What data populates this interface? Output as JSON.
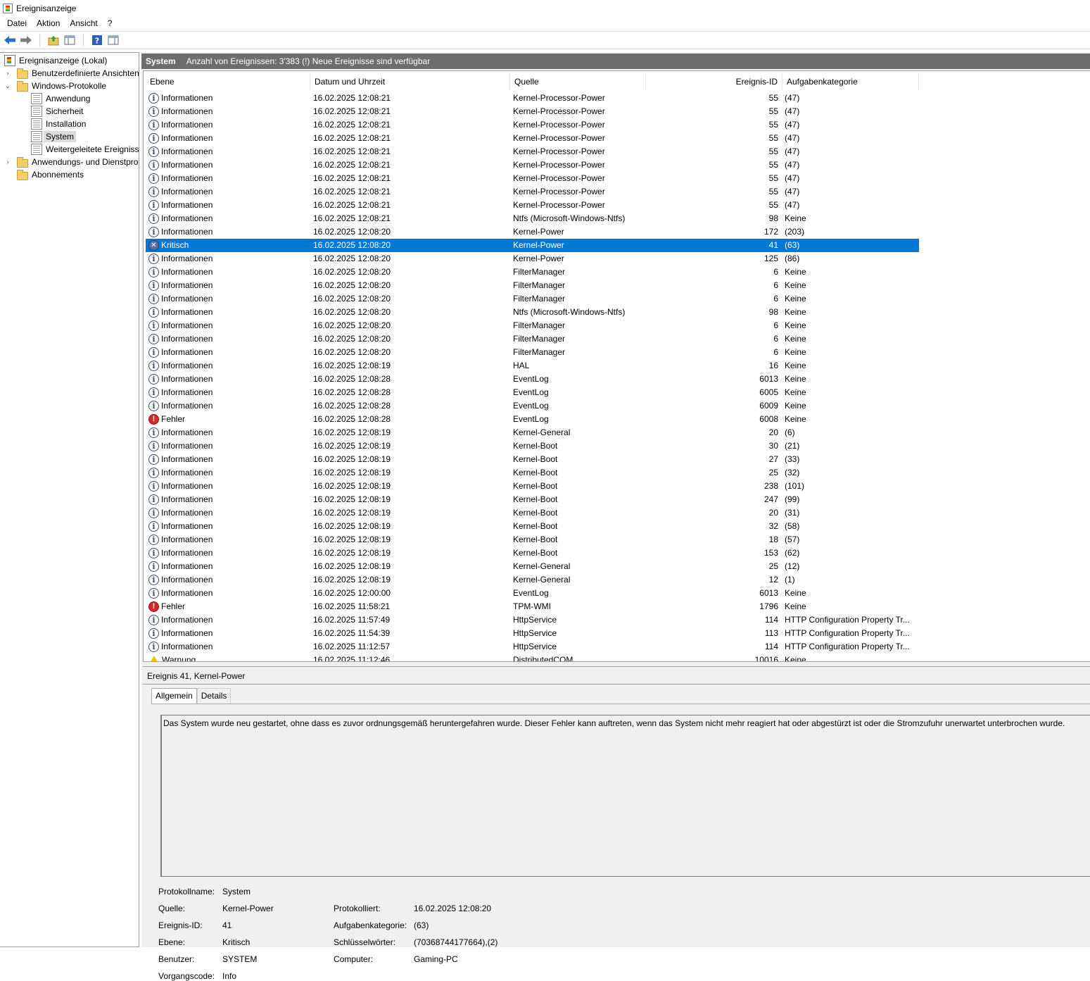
{
  "window": {
    "title": "Ereignisanzeige"
  },
  "menu": [
    "Datei",
    "Aktion",
    "Ansicht",
    "?"
  ],
  "toolbar": {
    "icons": [
      "back-arrow-icon",
      "forward-arrow-icon",
      "up-folder-icon",
      "show-hide-console-tree-icon",
      "help-icon",
      "show-hide-action-pane-icon"
    ],
    "colors": {
      "arrow": "#2b6fc9",
      "folder": "#3b9a3b"
    }
  },
  "tree": {
    "items": [
      {
        "label": "Ereignisanzeige (Lokal)",
        "icon": "event-viewer-icon",
        "level": 0,
        "chevron": ""
      },
      {
        "label": "Benutzerdefinierte Ansichten",
        "icon": "folder-icon",
        "level": 1,
        "chevron": "›"
      },
      {
        "label": "Windows-Protokolle",
        "icon": "folder-icon",
        "level": 1,
        "chevron": "⌄"
      },
      {
        "label": "Anwendung",
        "icon": "log-icon",
        "level": 2,
        "chevron": ""
      },
      {
        "label": "Sicherheit",
        "icon": "log-icon",
        "level": 2,
        "chevron": ""
      },
      {
        "label": "Installation",
        "icon": "log-icon",
        "level": 2,
        "chevron": ""
      },
      {
        "label": "System",
        "icon": "log-icon",
        "level": 2,
        "chevron": "",
        "selected": true
      },
      {
        "label": "Weitergeleitete Ereignisse",
        "icon": "log-icon",
        "level": 2,
        "chevron": ""
      },
      {
        "label": "Anwendungs- und Dienstprotokolle",
        "icon": "folder-icon",
        "level": 1,
        "chevron": "›"
      },
      {
        "label": "Abonnements",
        "icon": "subscriptions-icon",
        "level": 1,
        "chevron": ""
      }
    ]
  },
  "header": {
    "title": "System",
    "info": "Anzahl von Ereignissen: 3'383 (!) Neue Ereignisse sind verfügbar",
    "color": "#6d6d6d"
  },
  "columns": [
    "Ebene",
    "Datum und Uhrzeit",
    "Quelle",
    "Ereignis-ID",
    "Aufgabenkategorie"
  ],
  "events": [
    {
      "level": "Informationen",
      "type": "info",
      "date": "16.02.2025 12:08:21",
      "source": "Kernel-Processor-Power",
      "id": "55",
      "cat": "(47)"
    },
    {
      "level": "Informationen",
      "type": "info",
      "date": "16.02.2025 12:08:21",
      "source": "Kernel-Processor-Power",
      "id": "55",
      "cat": "(47)"
    },
    {
      "level": "Informationen",
      "type": "info",
      "date": "16.02.2025 12:08:21",
      "source": "Kernel-Processor-Power",
      "id": "55",
      "cat": "(47)"
    },
    {
      "level": "Informationen",
      "type": "info",
      "date": "16.02.2025 12:08:21",
      "source": "Kernel-Processor-Power",
      "id": "55",
      "cat": "(47)"
    },
    {
      "level": "Informationen",
      "type": "info",
      "date": "16.02.2025 12:08:21",
      "source": "Kernel-Processor-Power",
      "id": "55",
      "cat": "(47)"
    },
    {
      "level": "Informationen",
      "type": "info",
      "date": "16.02.2025 12:08:21",
      "source": "Kernel-Processor-Power",
      "id": "55",
      "cat": "(47)"
    },
    {
      "level": "Informationen",
      "type": "info",
      "date": "16.02.2025 12:08:21",
      "source": "Kernel-Processor-Power",
      "id": "55",
      "cat": "(47)"
    },
    {
      "level": "Informationen",
      "type": "info",
      "date": "16.02.2025 12:08:21",
      "source": "Kernel-Processor-Power",
      "id": "55",
      "cat": "(47)"
    },
    {
      "level": "Informationen",
      "type": "info",
      "date": "16.02.2025 12:08:21",
      "source": "Kernel-Processor-Power",
      "id": "55",
      "cat": "(47)"
    },
    {
      "level": "Informationen",
      "type": "info",
      "date": "16.02.2025 12:08:21",
      "source": "Ntfs (Microsoft-Windows-Ntfs)",
      "id": "98",
      "cat": "Keine"
    },
    {
      "level": "Informationen",
      "type": "info",
      "date": "16.02.2025 12:08:20",
      "source": "Kernel-Power",
      "id": "172",
      "cat": "(203)"
    },
    {
      "level": "Kritisch",
      "type": "critical",
      "date": "16.02.2025 12:08:20",
      "source": "Kernel-Power",
      "id": "41",
      "cat": "(63)",
      "selected": true
    },
    {
      "level": "Informationen",
      "type": "info",
      "date": "16.02.2025 12:08:20",
      "source": "Kernel-Power",
      "id": "125",
      "cat": "(86)"
    },
    {
      "level": "Informationen",
      "type": "info",
      "date": "16.02.2025 12:08:20",
      "source": "FilterManager",
      "id": "6",
      "cat": "Keine"
    },
    {
      "level": "Informationen",
      "type": "info",
      "date": "16.02.2025 12:08:20",
      "source": "FilterManager",
      "id": "6",
      "cat": "Keine"
    },
    {
      "level": "Informationen",
      "type": "info",
      "date": "16.02.2025 12:08:20",
      "source": "FilterManager",
      "id": "6",
      "cat": "Keine"
    },
    {
      "level": "Informationen",
      "type": "info",
      "date": "16.02.2025 12:08:20",
      "source": "Ntfs (Microsoft-Windows-Ntfs)",
      "id": "98",
      "cat": "Keine"
    },
    {
      "level": "Informationen",
      "type": "info",
      "date": "16.02.2025 12:08:20",
      "source": "FilterManager",
      "id": "6",
      "cat": "Keine"
    },
    {
      "level": "Informationen",
      "type": "info",
      "date": "16.02.2025 12:08:20",
      "source": "FilterManager",
      "id": "6",
      "cat": "Keine"
    },
    {
      "level": "Informationen",
      "type": "info",
      "date": "16.02.2025 12:08:20",
      "source": "FilterManager",
      "id": "6",
      "cat": "Keine"
    },
    {
      "level": "Informationen",
      "type": "info",
      "date": "16.02.2025 12:08:19",
      "source": "HAL",
      "id": "16",
      "cat": "Keine"
    },
    {
      "level": "Informationen",
      "type": "info",
      "date": "16.02.2025 12:08:28",
      "source": "EventLog",
      "id": "6013",
      "cat": "Keine"
    },
    {
      "level": "Informationen",
      "type": "info",
      "date": "16.02.2025 12:08:28",
      "source": "EventLog",
      "id": "6005",
      "cat": "Keine"
    },
    {
      "level": "Informationen",
      "type": "info",
      "date": "16.02.2025 12:08:28",
      "source": "EventLog",
      "id": "6009",
      "cat": "Keine"
    },
    {
      "level": "Fehler",
      "type": "error",
      "date": "16.02.2025 12:08:28",
      "source": "EventLog",
      "id": "6008",
      "cat": "Keine"
    },
    {
      "level": "Informationen",
      "type": "info",
      "date": "16.02.2025 12:08:19",
      "source": "Kernel-General",
      "id": "20",
      "cat": "(6)"
    },
    {
      "level": "Informationen",
      "type": "info",
      "date": "16.02.2025 12:08:19",
      "source": "Kernel-Boot",
      "id": "30",
      "cat": "(21)"
    },
    {
      "level": "Informationen",
      "type": "info",
      "date": "16.02.2025 12:08:19",
      "source": "Kernel-Boot",
      "id": "27",
      "cat": "(33)"
    },
    {
      "level": "Informationen",
      "type": "info",
      "date": "16.02.2025 12:08:19",
      "source": "Kernel-Boot",
      "id": "25",
      "cat": "(32)"
    },
    {
      "level": "Informationen",
      "type": "info",
      "date": "16.02.2025 12:08:19",
      "source": "Kernel-Boot",
      "id": "238",
      "cat": "(101)"
    },
    {
      "level": "Informationen",
      "type": "info",
      "date": "16.02.2025 12:08:19",
      "source": "Kernel-Boot",
      "id": "247",
      "cat": "(99)"
    },
    {
      "level": "Informationen",
      "type": "info",
      "date": "16.02.2025 12:08:19",
      "source": "Kernel-Boot",
      "id": "20",
      "cat": "(31)"
    },
    {
      "level": "Informationen",
      "type": "info",
      "date": "16.02.2025 12:08:19",
      "source": "Kernel-Boot",
      "id": "32",
      "cat": "(58)"
    },
    {
      "level": "Informationen",
      "type": "info",
      "date": "16.02.2025 12:08:19",
      "source": "Kernel-Boot",
      "id": "18",
      "cat": "(57)"
    },
    {
      "level": "Informationen",
      "type": "info",
      "date": "16.02.2025 12:08:19",
      "source": "Kernel-Boot",
      "id": "153",
      "cat": "(62)"
    },
    {
      "level": "Informationen",
      "type": "info",
      "date": "16.02.2025 12:08:19",
      "source": "Kernel-General",
      "id": "25",
      "cat": "(12)"
    },
    {
      "level": "Informationen",
      "type": "info",
      "date": "16.02.2025 12:08:19",
      "source": "Kernel-General",
      "id": "12",
      "cat": "(1)"
    },
    {
      "level": "Informationen",
      "type": "info",
      "date": "16.02.2025 12:00:00",
      "source": "EventLog",
      "id": "6013",
      "cat": "Keine"
    },
    {
      "level": "Fehler",
      "type": "error",
      "date": "16.02.2025 11:58:21",
      "source": "TPM-WMI",
      "id": "1796",
      "cat": "Keine"
    },
    {
      "level": "Informationen",
      "type": "info",
      "date": "16.02.2025 11:57:49",
      "source": "HttpService",
      "id": "114",
      "cat": "HTTP Configuration Property Tr..."
    },
    {
      "level": "Informationen",
      "type": "info",
      "date": "16.02.2025 11:54:39",
      "source": "HttpService",
      "id": "113",
      "cat": "HTTP Configuration Property Tr..."
    },
    {
      "level": "Informationen",
      "type": "info",
      "date": "16.02.2025 11:12:57",
      "source": "HttpService",
      "id": "114",
      "cat": "HTTP Configuration Property Tr..."
    },
    {
      "level": "Warnung",
      "type": "warning",
      "date": "16.02.2025 11:12:46",
      "source": "DistributedCOM",
      "id": "10016",
      "cat": "Keine"
    }
  ],
  "detail": {
    "title": "Ereignis 41, Kernel-Power",
    "tabs": [
      "Allgemein",
      "Details"
    ],
    "description": "Das System wurde neu gestartet, ohne dass es zuvor ordnungsgemäß heruntergefahren wurde. Dieser Fehler kann auftreten, wenn das System nicht mehr reagiert hat oder abgestürzt ist oder die Stromzufuhr unerwartet unterbrochen wurde.",
    "props": {
      "log_name_label": "Protokollname:",
      "log_name": "System",
      "source_label": "Quelle:",
      "source": "Kernel-Power",
      "logged_label": "Protokolliert:",
      "logged": "16.02.2025 12:08:20",
      "event_id_label": "Ereignis-ID:",
      "event_id": "41",
      "task_cat_label": "Aufgabenkategorie:",
      "task_cat": "(63)",
      "level_label": "Ebene:",
      "level": "Kritisch",
      "keywords_label": "Schlüsselwörter:",
      "keywords": "(70368744177664),(2)",
      "user_label": "Benutzer:",
      "user": "SYSTEM",
      "computer_label": "Computer:",
      "computer": "Gaming-PC",
      "opcode_label": "Vorgangscode:",
      "opcode": "Info"
    }
  },
  "selection_color": "#0078d7"
}
